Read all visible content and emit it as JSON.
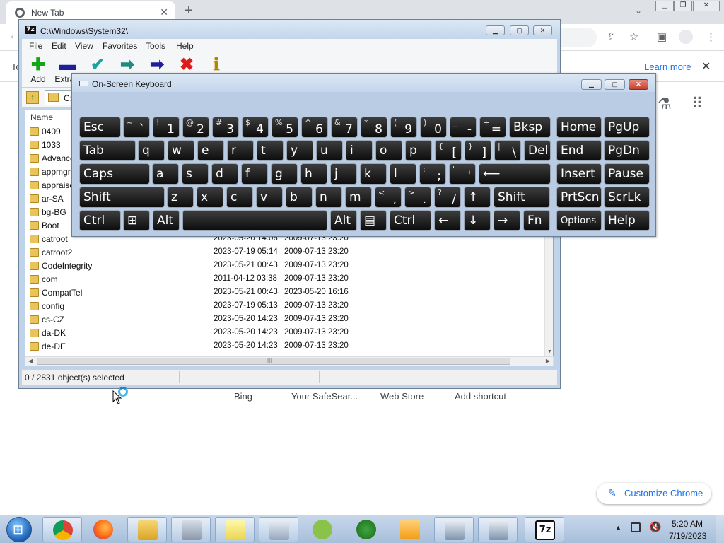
{
  "chrome": {
    "tab_title": "New Tab",
    "infobar_text": "To",
    "learn_more": "Learn more",
    "shortcuts": [
      "Bing",
      "Your SafeSear...",
      "Web Store",
      "Add shortcut"
    ],
    "customize_label": "Customize Chrome"
  },
  "sevenzip": {
    "title": "C:\\Windows\\System32\\",
    "app_icon_text": "7z",
    "menu": [
      "File",
      "Edit",
      "View",
      "Favorites",
      "Tools",
      "Help"
    ],
    "tools": [
      {
        "label": "Add",
        "glyph": "✚"
      },
      {
        "label": "Extract",
        "glyph": "▬"
      },
      {
        "label": "",
        "glyph": "✔"
      },
      {
        "label": "",
        "glyph": "➡"
      },
      {
        "label": "",
        "glyph": "➡"
      },
      {
        "label": "",
        "glyph": "✖"
      },
      {
        "label": "",
        "glyph": "ℹ"
      }
    ],
    "path": "C:",
    "column_name": "Name",
    "rows": [
      {
        "name": "0409",
        "modified": "",
        "created": ""
      },
      {
        "name": "1033",
        "modified": "",
        "created": ""
      },
      {
        "name": "Advance",
        "modified": "",
        "created": ""
      },
      {
        "name": "appmgr",
        "modified": "",
        "created": ""
      },
      {
        "name": "appraise",
        "modified": "",
        "created": ""
      },
      {
        "name": "ar-SA",
        "modified": "",
        "created": ""
      },
      {
        "name": "bg-BG",
        "modified": "",
        "created": ""
      },
      {
        "name": "Boot",
        "modified": "",
        "created": ""
      },
      {
        "name": "catroot",
        "modified": "2023-05-20 14:06",
        "created": "2009-07-13 23:20"
      },
      {
        "name": "catroot2",
        "modified": "2023-07-19 05:14",
        "created": "2009-07-13 23:20"
      },
      {
        "name": "CodeIntegrity",
        "modified": "2023-05-21 00:43",
        "created": "2009-07-13 23:20"
      },
      {
        "name": "com",
        "modified": "2011-04-12 03:38",
        "created": "2009-07-13 23:20"
      },
      {
        "name": "CompatTel",
        "modified": "2023-05-21 00:43",
        "created": "2023-05-20 16:16"
      },
      {
        "name": "config",
        "modified": "2023-07-19 05:13",
        "created": "2009-07-13 23:20"
      },
      {
        "name": "cs-CZ",
        "modified": "2023-05-20 14:23",
        "created": "2009-07-13 23:20"
      },
      {
        "name": "da-DK",
        "modified": "2023-05-20 14:23",
        "created": "2009-07-13 23:20"
      },
      {
        "name": "de-DE",
        "modified": "2023-05-20 14:23",
        "created": "2009-07-13 23:20"
      }
    ],
    "status": "0 / 2831 object(s) selected"
  },
  "osk": {
    "title": "On-Screen Keyboard",
    "keys": [
      {
        "l": "Esc"
      },
      {
        "s": "~",
        "m": "`"
      },
      {
        "s": "!",
        "m": "1"
      },
      {
        "s": "@",
        "m": "2"
      },
      {
        "s": "#",
        "m": "3"
      },
      {
        "s": "$",
        "m": "4"
      },
      {
        "s": "%",
        "m": "5"
      },
      {
        "s": "^",
        "m": "6"
      },
      {
        "s": "&",
        "m": "7"
      },
      {
        "s": "*",
        "m": "8"
      },
      {
        "s": "(",
        "m": "9"
      },
      {
        "s": ")",
        "m": "0"
      },
      {
        "s": "_",
        "m": "-"
      },
      {
        "s": "+",
        "m": "="
      },
      {
        "l": "Bksp"
      },
      {
        "l": "Home"
      },
      {
        "l": "PgUp"
      },
      {
        "l": "Tab"
      },
      {
        "l": "q"
      },
      {
        "l": "w"
      },
      {
        "l": "e"
      },
      {
        "l": "r"
      },
      {
        "l": "t"
      },
      {
        "l": "y"
      },
      {
        "l": "u"
      },
      {
        "l": "i"
      },
      {
        "l": "o"
      },
      {
        "l": "p"
      },
      {
        "s": "{",
        "m": "["
      },
      {
        "s": "}",
        "m": "]"
      },
      {
        "s": "|",
        "m": "\\"
      },
      {
        "l": "Del"
      },
      {
        "l": "End"
      },
      {
        "l": "PgDn"
      },
      {
        "l": "Caps"
      },
      {
        "l": "a"
      },
      {
        "l": "s"
      },
      {
        "l": "d"
      },
      {
        "l": "f"
      },
      {
        "l": "g"
      },
      {
        "l": "h"
      },
      {
        "l": "j"
      },
      {
        "l": "k"
      },
      {
        "l": "l"
      },
      {
        "s": ":",
        "m": ";"
      },
      {
        "s": "\"",
        "m": "'"
      },
      {
        "l": "⟵"
      },
      {
        "l": "Insert"
      },
      {
        "l": "Pause"
      },
      {
        "l": "Shift"
      },
      {
        "l": "z"
      },
      {
        "l": "x"
      },
      {
        "l": "c"
      },
      {
        "l": "v"
      },
      {
        "l": "b"
      },
      {
        "l": "n"
      },
      {
        "l": "m"
      },
      {
        "s": "<",
        "m": ","
      },
      {
        "s": ">",
        "m": "."
      },
      {
        "s": "?",
        "m": "/"
      },
      {
        "l": "↑"
      },
      {
        "l": "Shift"
      },
      {
        "l": "PrtScn"
      },
      {
        "l": "ScrLk"
      },
      {
        "l": "Ctrl"
      },
      {
        "l": "⊞"
      },
      {
        "l": "Alt"
      },
      {
        "l": ""
      },
      {
        "l": "Alt"
      },
      {
        "l": "▤"
      },
      {
        "l": "Ctrl"
      },
      {
        "l": "←"
      },
      {
        "l": "↓"
      },
      {
        "l": "→"
      },
      {
        "l": "Fn"
      },
      {
        "l": "Options"
      },
      {
        "l": "Help"
      }
    ]
  },
  "taskbar": {
    "time": "5:20 AM",
    "date": "7/19/2023"
  }
}
